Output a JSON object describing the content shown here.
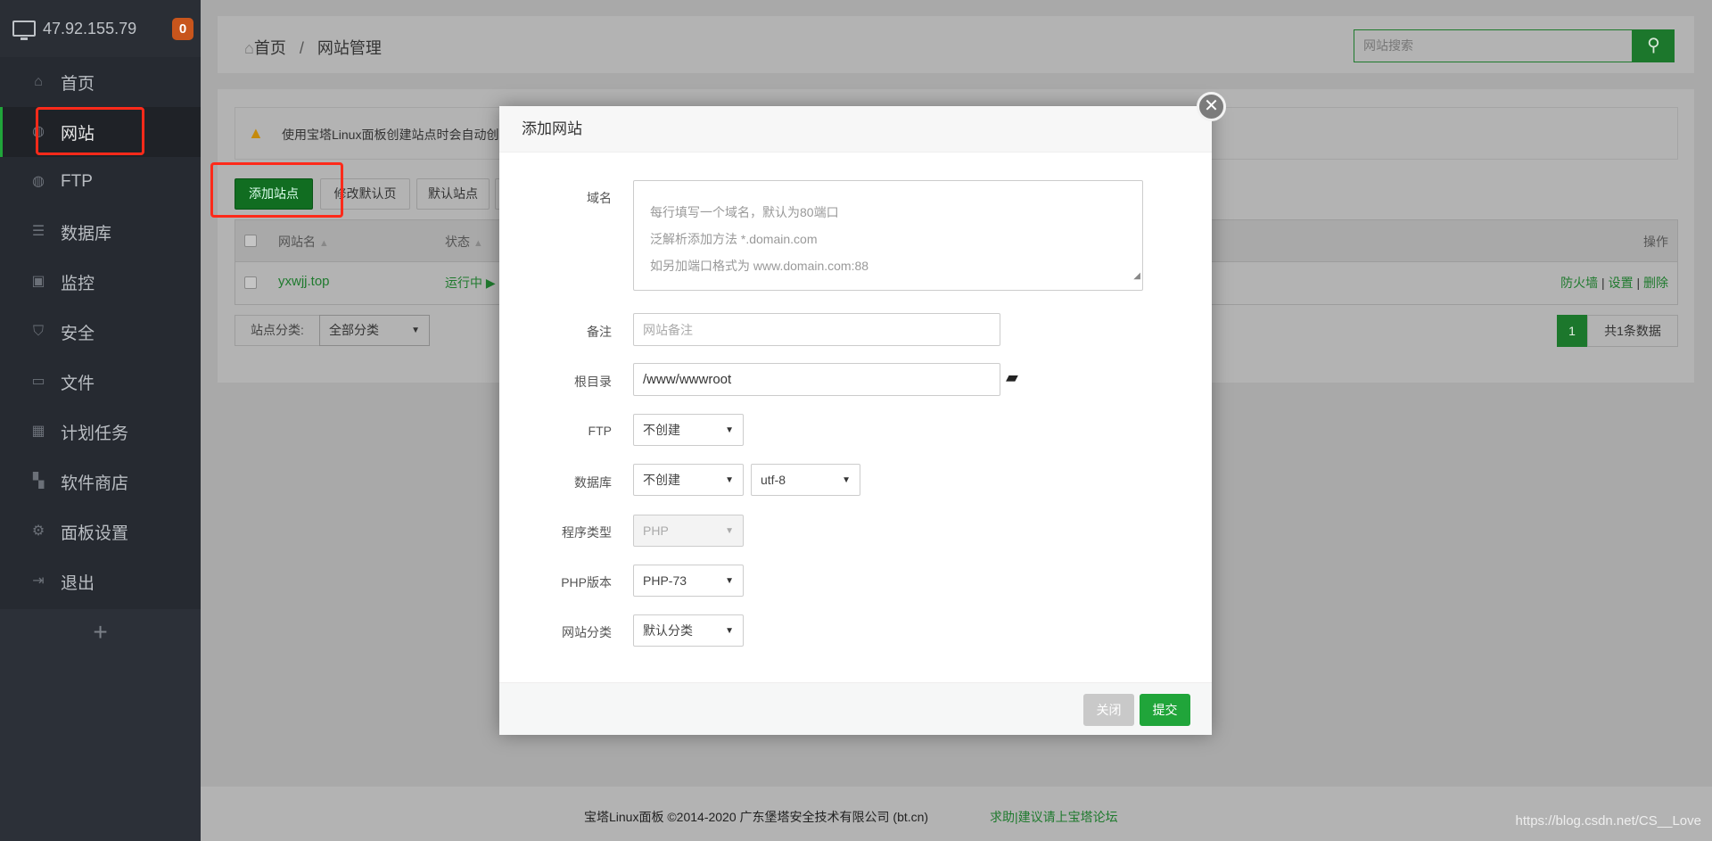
{
  "sidebar": {
    "server_ip": "47.92.155.79",
    "badge": "0",
    "items": [
      {
        "label": "首页",
        "icon": "home-icon"
      },
      {
        "label": "网站",
        "icon": "globe-icon",
        "active": true
      },
      {
        "label": "FTP",
        "icon": "ftp-icon"
      },
      {
        "label": "数据库",
        "icon": "database-icon"
      },
      {
        "label": "监控",
        "icon": "monitor-icon"
      },
      {
        "label": "安全",
        "icon": "shield-icon"
      },
      {
        "label": "文件",
        "icon": "folder-icon"
      },
      {
        "label": "计划任务",
        "icon": "calendar-icon"
      },
      {
        "label": "软件商店",
        "icon": "apps-icon"
      },
      {
        "label": "面板设置",
        "icon": "gear-icon"
      },
      {
        "label": "退出",
        "icon": "logout-icon"
      }
    ],
    "add": "+"
  },
  "header": {
    "breadcrumb_home": "首页",
    "breadcrumb_sep": "/",
    "breadcrumb_current": "网站管理",
    "search_placeholder": "网站搜索"
  },
  "main": {
    "alert": "使用宝塔Linux面板创建站点时会自动创",
    "buttons": {
      "add_site": "添加站点",
      "edit_default": "修改默认页",
      "default_site": "默认站点"
    },
    "table": {
      "headers": {
        "name": "网站名",
        "status": "状态",
        "actions": "操作"
      },
      "rows": [
        {
          "name": "yxwjj.top",
          "status": "运行中",
          "actions": [
            "防火墙",
            "设置",
            "删除"
          ]
        }
      ]
    },
    "category_label": "站点分类:",
    "category_value": "全部分类",
    "page": "1",
    "total": "共1条数据"
  },
  "modal": {
    "title": "添加网站",
    "domain_label": "域名",
    "domain_placeholder_lines": [
      "每行填写一个域名，默认为80端口",
      "泛解析添加方法 *.domain.com",
      "如另加端口格式为 www.domain.com:88"
    ],
    "remark_label": "备注",
    "remark_placeholder": "网站备注",
    "root_label": "根目录",
    "root_value": "/www/wwwroot",
    "ftp_label": "FTP",
    "ftp_value": "不创建",
    "db_label": "数据库",
    "db_value": "不创建",
    "db_charset": "utf-8",
    "type_label": "程序类型",
    "type_value": "PHP",
    "php_label": "PHP版本",
    "php_value": "PHP-73",
    "cat_label": "网站分类",
    "cat_value": "默认分类",
    "close_btn": "关闭",
    "submit_btn": "提交"
  },
  "footer": {
    "copyright": "宝塔Linux面板 ©2014-2020 广东堡塔安全技术有限公司 (bt.cn)",
    "help": "求助|建议请上宝塔论坛",
    "watermark": "https://blog.csdn.net/CS__Love"
  },
  "colors": {
    "accent": "#20a53a",
    "sidebar": "#262a31",
    "highlight": "#ff2a1a"
  }
}
